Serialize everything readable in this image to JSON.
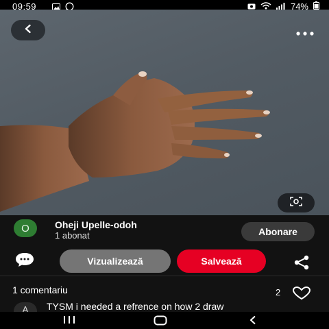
{
  "status_bar": {
    "time": "09:59",
    "battery": "74%",
    "left_icons": [
      "gallery-icon",
      "whatsapp-icon"
    ],
    "right_icons": [
      "screenshot-icon",
      "wifi-icon",
      "signal-icon",
      "battery-icon"
    ]
  },
  "pin": {
    "image_description_icon": "hand-photo",
    "top_left_icon": "back-arrow-icon",
    "top_right_icon": "more-options-icon",
    "lens_icon": "visual-search-icon"
  },
  "author": {
    "avatar_letter": "O",
    "name": "Oheji Upelle-odoh",
    "subscribers": "1 abonat",
    "follow_label": "Abonare"
  },
  "actions": {
    "view_label": "Vizualizează",
    "save_label": "Salvează",
    "comment_icon": "comment-icon",
    "share_icon": "share-icon"
  },
  "comments": {
    "count_label": "1 comentariu",
    "likes": "2",
    "first_comment": {
      "avatar_letter": "A",
      "text": "TYSM i needed a refrence on how 2 draw"
    }
  },
  "colors": {
    "save": "#e60023",
    "view": "#757575",
    "follow": "#3a3a3a",
    "avatar": "#2e7d32"
  },
  "nav_bar": {
    "icons": [
      "recents-icon",
      "home-icon",
      "back-icon"
    ]
  }
}
